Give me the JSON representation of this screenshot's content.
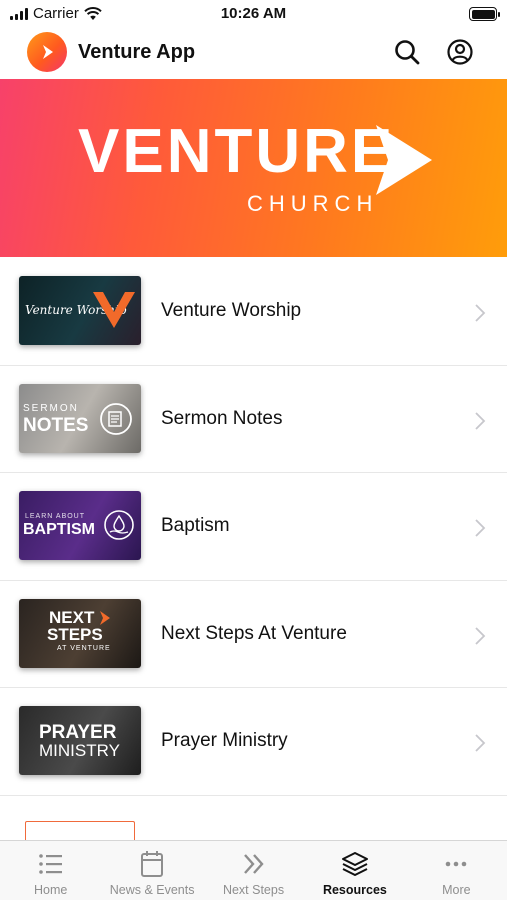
{
  "status_bar": {
    "carrier": "Carrier",
    "time": "10:26 AM"
  },
  "header": {
    "title": "Venture App"
  },
  "hero": {
    "word": "VENTURE",
    "sub": "CHURCH"
  },
  "items": [
    {
      "label": "Venture Worship",
      "thumb_text": "Venture Worship"
    },
    {
      "label": "Sermon Notes",
      "thumb_text_top": "SERMON",
      "thumb_text_bottom": "NOTES"
    },
    {
      "label": "Baptism",
      "thumb_text_top": "LEARN ABOUT",
      "thumb_text_bottom": "BAPTISM"
    },
    {
      "label": "Next Steps At Venture",
      "thumb_text_top": "NEXT",
      "thumb_text_mid": "STEPS",
      "thumb_text_bottom": "AT VENTURE"
    },
    {
      "label": "Prayer Ministry",
      "thumb_text_top": "PRAYER",
      "thumb_text_bottom": "MINISTRY"
    }
  ],
  "tabs": [
    {
      "label": "Home",
      "icon": "list-icon"
    },
    {
      "label": "News & Events",
      "icon": "calendar-icon"
    },
    {
      "label": "Next Steps",
      "icon": "double-chevron-icon"
    },
    {
      "label": "Resources",
      "icon": "stack-icon",
      "active": true
    },
    {
      "label": "More",
      "icon": "more-icon"
    }
  ],
  "colors": {
    "brand_orange": "#ff7a1e",
    "brand_pink": "#f7416a",
    "text": "#111111",
    "inactive_tab": "#8e8e8e"
  }
}
